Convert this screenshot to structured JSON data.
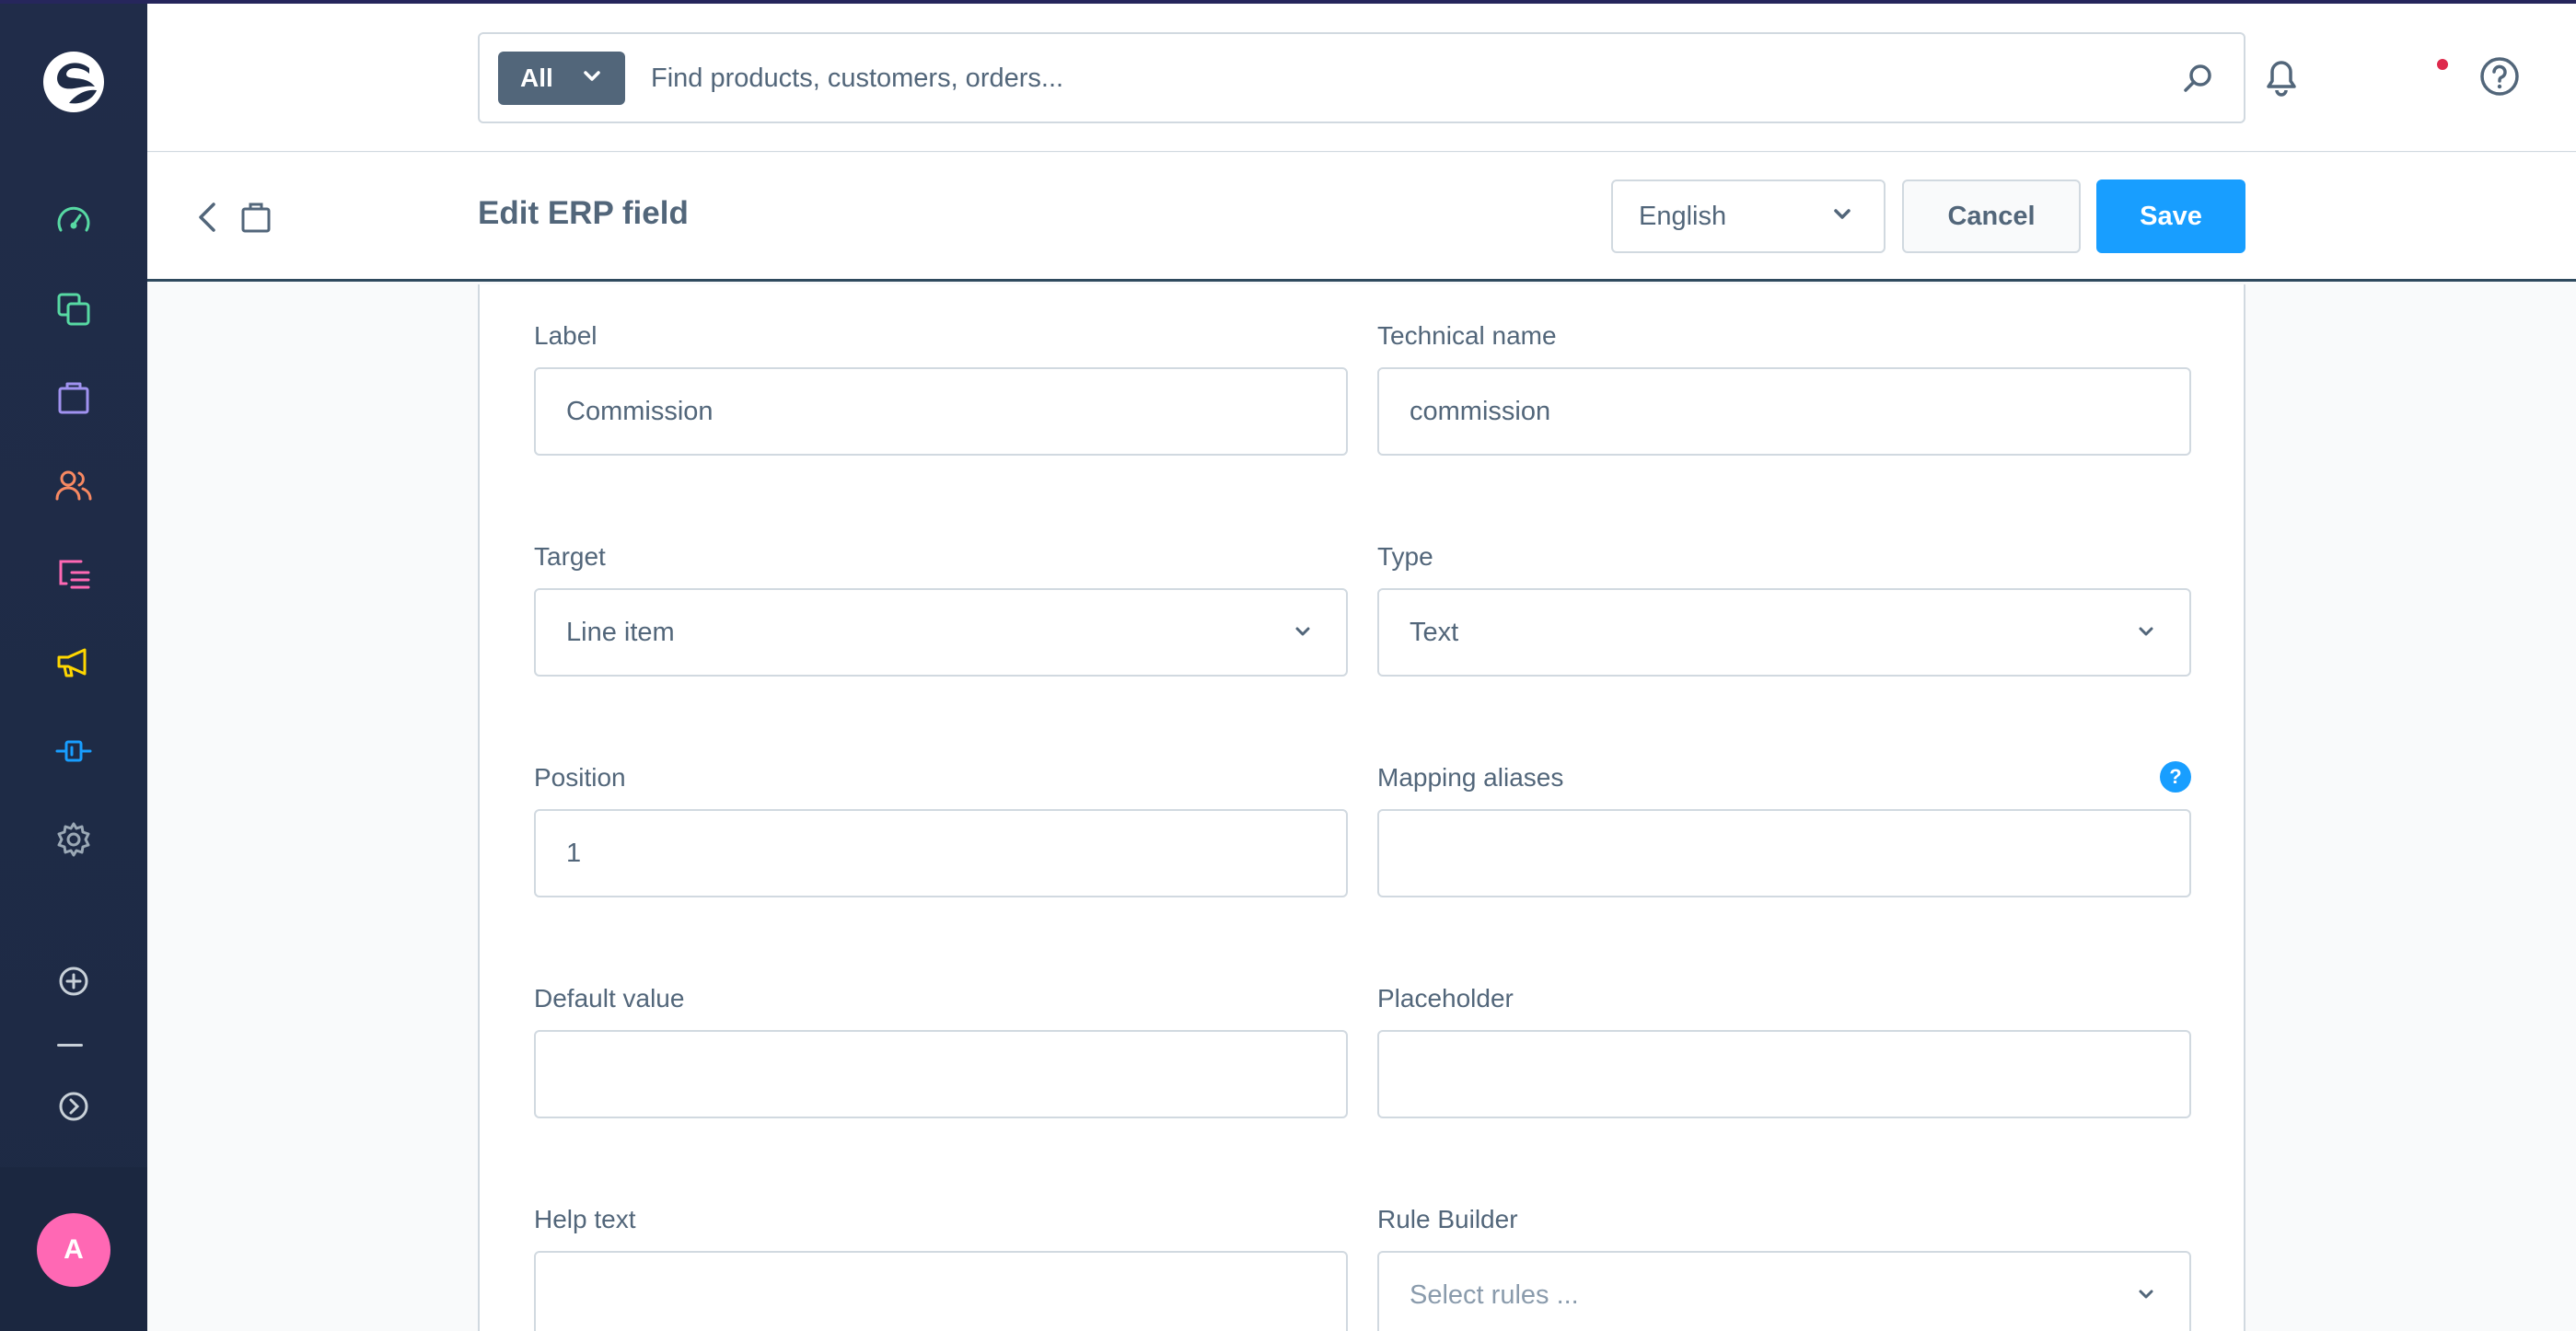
{
  "header": {
    "search": {
      "type_label": "All",
      "placeholder": "Find products, customers, orders..."
    }
  },
  "sidebar": {
    "items": [
      {
        "name": "dashboard",
        "icon": "dashboard-gauge-icon",
        "color": "#57d9a3"
      },
      {
        "name": "catalogues",
        "icon": "products-stack-icon",
        "color": "#57d9a3"
      },
      {
        "name": "orders",
        "icon": "shopping-bag-icon",
        "color": "#a092f0"
      },
      {
        "name": "customers",
        "icon": "users-icon",
        "color": "#f88962"
      },
      {
        "name": "content",
        "icon": "content-list-icon",
        "color": "#ff68b4"
      },
      {
        "name": "marketing",
        "icon": "megaphone-icon",
        "color": "#ffd700"
      },
      {
        "name": "extensions",
        "icon": "plugin-icon",
        "color": "#189eff"
      },
      {
        "name": "settings",
        "icon": "gear-icon",
        "color": "#9aa8b5"
      }
    ],
    "avatar_initial": "A"
  },
  "smartbar": {
    "title": "Edit ERP field",
    "language": "English",
    "cancel_label": "Cancel",
    "save_label": "Save"
  },
  "form": {
    "label": {
      "label": "Label",
      "value": "Commission"
    },
    "technical_name": {
      "label": "Technical name",
      "value": "commission"
    },
    "target": {
      "label": "Target",
      "value": "Line item"
    },
    "type": {
      "label": "Type",
      "value": "Text"
    },
    "position": {
      "label": "Position",
      "value": "1"
    },
    "mapping_aliases": {
      "label": "Mapping aliases",
      "value": "",
      "help": "?"
    },
    "default_value": {
      "label": "Default value",
      "value": ""
    },
    "placeholder": {
      "label": "Placeholder",
      "value": ""
    },
    "help_text": {
      "label": "Help text",
      "value": ""
    },
    "rule_builder": {
      "label": "Rule Builder",
      "placeholder": "Select rules ..."
    }
  },
  "colors": {
    "sidebar_bg": "#1e2b45",
    "primary": "#189eff",
    "text": "#52667a",
    "border": "#d1d9e0",
    "avatar": "#ff68b4",
    "notification": "#de294c"
  }
}
